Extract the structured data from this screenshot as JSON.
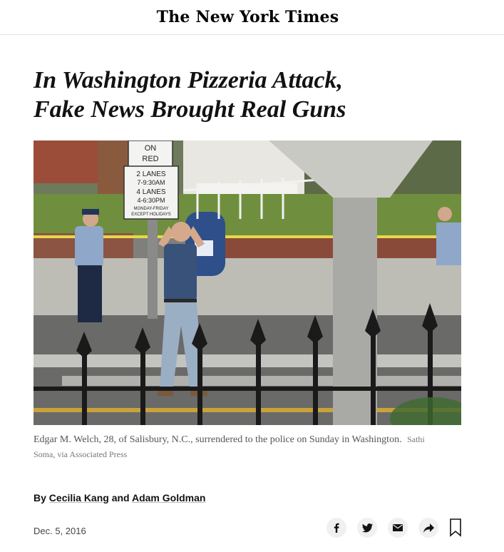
{
  "masthead": {
    "logo_text": "The New York Times"
  },
  "article": {
    "headline_line1": "In Washington Pizzeria Attack,",
    "headline_line2": "Fake News Brought Real Guns",
    "photo": {
      "caption": "Edgar M. Welch, 28, of Salisbury, N.C., surrendered to the police on Sunday in Washington.",
      "credit": "Sathi Soma, via Associated Press",
      "signs": {
        "on_red_1": "ON",
        "on_red_2": "RED",
        "lanes_1": "2 LANES",
        "lanes_2": "7-9:30AM",
        "lanes_3": "4 LANES",
        "lanes_4": "4-6:30PM",
        "lanes_5": "MONDAY-FRIDAY",
        "lanes_6": "EXCEPT HOLIDAYS"
      }
    },
    "byline": {
      "prefix": "By",
      "author1": "Cecilia Kang",
      "conjunction": "and",
      "author2": "Adam Goldman"
    },
    "date": "Dec. 5, 2016"
  },
  "share": {
    "icons": [
      "facebook-icon",
      "twitter-icon",
      "email-icon",
      "share-icon",
      "bookmark-icon"
    ]
  },
  "colors": {
    "text": "#121212",
    "caption": "#555555",
    "divider": "#e2e2e2",
    "share_bg": "#f0f0f0"
  }
}
